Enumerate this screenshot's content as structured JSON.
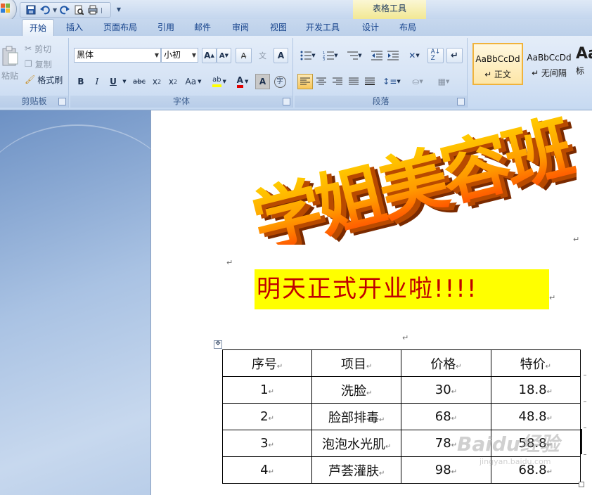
{
  "titlebar": {
    "context_tab": "表格工具"
  },
  "tabs": [
    {
      "label": "开始",
      "active": true
    },
    {
      "label": "插入"
    },
    {
      "label": "页面布局"
    },
    {
      "label": "引用"
    },
    {
      "label": "邮件"
    },
    {
      "label": "审阅"
    },
    {
      "label": "视图"
    },
    {
      "label": "开发工具"
    },
    {
      "label": "设计"
    },
    {
      "label": "布局"
    }
  ],
  "clipboard": {
    "paste": "粘贴",
    "cut": "剪切",
    "copy": "复制",
    "format_painter": "格式刷",
    "group_label": "剪贴板"
  },
  "font": {
    "name": "黑体",
    "size": "小初",
    "text_style_button": "Aa",
    "group_label": "字体"
  },
  "paragraph": {
    "group_label": "段落"
  },
  "styles": [
    {
      "sample": "AaBbCcDd",
      "name": "↵ 正文",
      "selected": true
    },
    {
      "sample": "AaBbCcDd",
      "name": "↵ 无间隔"
    },
    {
      "sample": "AaI",
      "name": "标"
    }
  ],
  "document": {
    "wordart": "学姐美容班",
    "headline": "明天正式开业啦!!!!",
    "paragraph_mark": "↵",
    "table": {
      "headers": [
        "序号",
        "项目",
        "价格",
        "特价"
      ],
      "rows": [
        [
          "1",
          "洗脸",
          "30",
          "18.8"
        ],
        [
          "2",
          "脸部排毒",
          "68",
          "48.8"
        ],
        [
          "3",
          "泡泡水光肌",
          "78",
          "58.8"
        ],
        [
          "4",
          "芦荟灌肤",
          "98",
          "68.8"
        ]
      ]
    }
  },
  "watermark": {
    "brand": "Baidu经验",
    "url": "jingyan.baidu.com"
  },
  "colors": {
    "headline_text": "#c00000",
    "headline_bg": "#ffff00",
    "wordart_top": "#ffb000",
    "wordart_side": "#b84a00",
    "ribbon_text": "#15428b"
  }
}
